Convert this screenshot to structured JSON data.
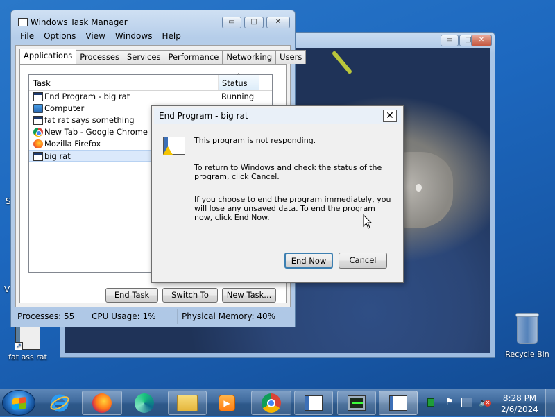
{
  "desktop": {
    "icons": [
      {
        "label": "fat ass rat",
        "icon": "window-shortcut-icon"
      },
      {
        "label": "Recycle Bin",
        "icon": "recycle-bin-icon"
      }
    ],
    "edge_letters": {
      "s": "S",
      "v": "V"
    }
  },
  "task_manager": {
    "title": "Windows Task Manager",
    "menu": [
      "File",
      "Options",
      "View",
      "Windows",
      "Help"
    ],
    "tabs": [
      "Applications",
      "Processes",
      "Services",
      "Performance",
      "Networking",
      "Users"
    ],
    "active_tab": "Applications",
    "columns": {
      "task": "Task",
      "status": "Status"
    },
    "tasks": [
      {
        "name": "End Program - big rat",
        "status": "Running",
        "icon": "window-icon"
      },
      {
        "name": "Computer",
        "status": "",
        "icon": "computer-icon"
      },
      {
        "name": "fat rat says something",
        "status": "",
        "icon": "window-icon"
      },
      {
        "name": "New Tab - Google Chrome",
        "status": "",
        "icon": "chrome-icon"
      },
      {
        "name": "Mozilla Firefox",
        "status": "",
        "icon": "firefox-icon"
      },
      {
        "name": "big rat",
        "status": "",
        "icon": "window-icon",
        "selected": true
      }
    ],
    "buttons": {
      "end_task": "End Task",
      "switch_to": "Switch To",
      "new_task": "New Task..."
    },
    "status_bar": {
      "processes": "Processes: 55",
      "cpu": "CPU Usage: 1%",
      "memory": "Physical Memory: 40%"
    },
    "caption_buttons": {
      "minimize": "▭",
      "maximize": "□",
      "close": "✕"
    }
  },
  "dialog": {
    "title": "End Program - big rat",
    "line1": "This program is not responding.",
    "line2": "To return to Windows and check the status of the program, click Cancel.",
    "line3": "If you choose to end the program immediately, you will lose any unsaved data. To end the program now, click End Now.",
    "end_now": "End Now",
    "cancel": "Cancel",
    "close": "✕"
  },
  "taskbar": {
    "items": [
      {
        "name": "ie",
        "icon": "internet-explorer-icon"
      },
      {
        "name": "firefox",
        "icon": "firefox-icon"
      },
      {
        "name": "edge-like",
        "icon": "green-swirl-icon"
      },
      {
        "name": "explorer",
        "icon": "folder-icon"
      },
      {
        "name": "media",
        "icon": "media-player-icon"
      },
      {
        "name": "chrome",
        "icon": "chrome-icon"
      },
      {
        "name": "app1",
        "icon": "window-icon"
      },
      {
        "name": "task-manager",
        "icon": "task-manager-icon"
      },
      {
        "name": "app2",
        "icon": "window-icon"
      }
    ],
    "clock": {
      "time": "8:28 PM",
      "date": "2/6/2024"
    }
  },
  "colors": {
    "accent": "#1d68bf",
    "selection": "#dbe9fb"
  }
}
